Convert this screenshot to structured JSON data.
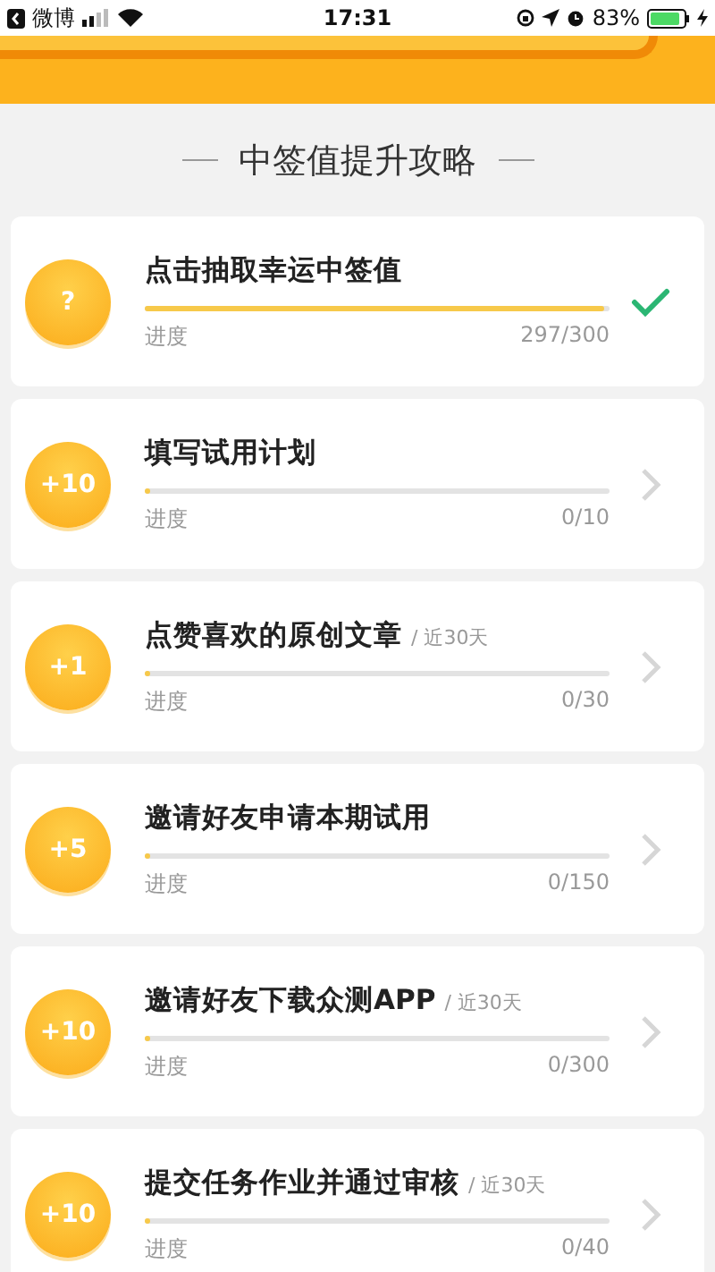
{
  "status_bar": {
    "back_app": "微博",
    "time": "17:31",
    "battery": "83%"
  },
  "title": "中签值提升攻略",
  "tasks": [
    {
      "badge": "?",
      "title": "点击抽取幸运中签值",
      "progress_label": "进度",
      "progress": "297/300",
      "level": 0.99,
      "completed": true
    },
    {
      "badge": "+10",
      "title": "填写试用计划",
      "progress_label": "进度",
      "progress": "0/10",
      "level": 0,
      "completed": false
    },
    {
      "badge": "+1",
      "title": "点赞喜欢的原创文章",
      "note": "/ 近30天",
      "progress_label": "进度",
      "progress": "0/30",
      "level": 0,
      "completed": false
    },
    {
      "badge": "+5",
      "title": "邀请好友申请本期试用",
      "progress_label": "进度",
      "progress": "0/150",
      "level": 0,
      "completed": false
    },
    {
      "badge": "+10",
      "title": "邀请好友下载众测APP",
      "note": "/ 近30天",
      "progress_label": "进度",
      "progress": "0/300",
      "level": 0,
      "completed": false
    },
    {
      "badge": "+10",
      "title": "提交任务作业并通过审核",
      "note": "/ 近30天",
      "progress_label": "进度",
      "progress": "0/40",
      "level": 0,
      "completed": false
    }
  ]
}
